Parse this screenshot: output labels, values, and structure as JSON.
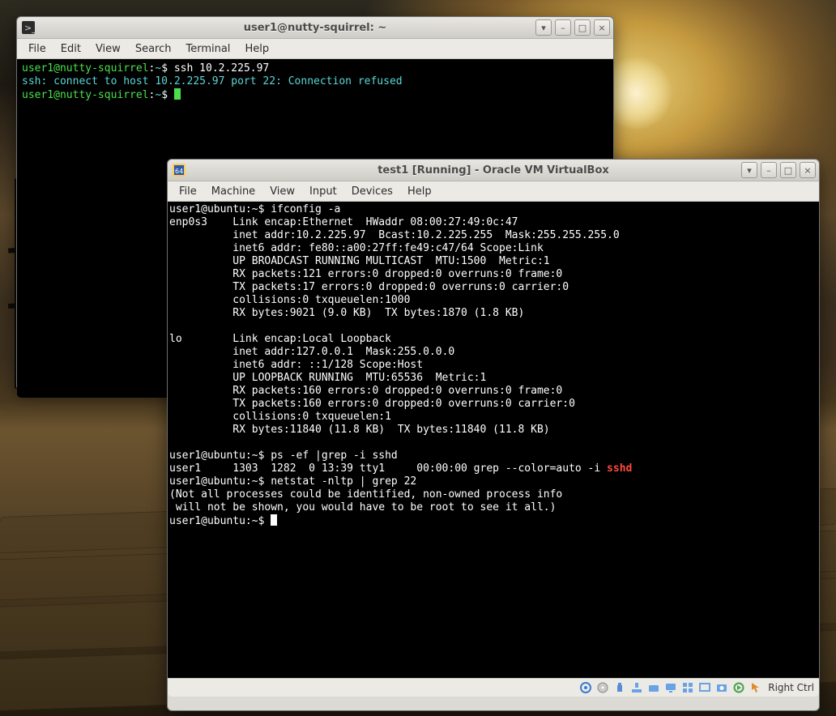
{
  "host_window": {
    "title": "user1@nutty-squirrel: ~",
    "menu": [
      "File",
      "Edit",
      "View",
      "Search",
      "Terminal",
      "Help"
    ],
    "controls": {
      "min": "–",
      "max": "□",
      "close": "×",
      "down": "▾"
    },
    "lines": {
      "p1_user": "user1@nutty-squirrel",
      "p1_path": "~",
      "p1_cmd": "ssh 10.2.225.97",
      "err": "ssh: connect to host 10.2.225.97 port 22: Connection refused",
      "p2_user": "user1@nutty-squirrel",
      "p2_path": "~"
    }
  },
  "vbox_window": {
    "title": "test1 [Running] - Oracle VM VirtualBox",
    "menu": [
      "File",
      "Machine",
      "View",
      "Input",
      "Devices",
      "Help"
    ],
    "controls": {
      "min": "–",
      "max": "□",
      "close": "×",
      "down": "▾"
    },
    "hostkey": "Right Ctrl",
    "status_icons": [
      "settings-icon",
      "cd-icon",
      "usb-icon",
      "network-icon",
      "shared-folder-icon",
      "display-icon",
      "fullscreen-icon",
      "seamless-icon",
      "snapshot-icon",
      "recording-icon",
      "mouse-icon"
    ],
    "term": {
      "l01": "user1@ubuntu:~$ ifconfig -a",
      "l02": "enp0s3    Link encap:Ethernet  HWaddr 08:00:27:49:0c:47",
      "l03": "          inet addr:10.2.225.97  Bcast:10.2.225.255  Mask:255.255.255.0",
      "l04": "          inet6 addr: fe80::a00:27ff:fe49:c47/64 Scope:Link",
      "l05": "          UP BROADCAST RUNNING MULTICAST  MTU:1500  Metric:1",
      "l06": "          RX packets:121 errors:0 dropped:0 overruns:0 frame:0",
      "l07": "          TX packets:17 errors:0 dropped:0 overruns:0 carrier:0",
      "l08": "          collisions:0 txqueuelen:1000",
      "l09": "          RX bytes:9021 (9.0 KB)  TX bytes:1870 (1.8 KB)",
      "l10": "",
      "l11": "lo        Link encap:Local Loopback",
      "l12": "          inet addr:127.0.0.1  Mask:255.0.0.0",
      "l13": "          inet6 addr: ::1/128 Scope:Host",
      "l14": "          UP LOOPBACK RUNNING  MTU:65536  Metric:1",
      "l15": "          RX packets:160 errors:0 dropped:0 overruns:0 frame:0",
      "l16": "          TX packets:160 errors:0 dropped:0 overruns:0 carrier:0",
      "l17": "          collisions:0 txqueuelen:1",
      "l18": "          RX bytes:11840 (11.8 KB)  TX bytes:11840 (11.8 KB)",
      "l19": "",
      "l20": "user1@ubuntu:~$ ps -ef |grep -i sshd",
      "l21a": "user1     1303  1282  0 13:39 tty1     00:00:00 grep --color=auto -i ",
      "l21b": "sshd",
      "l22": "user1@ubuntu:~$ netstat -nltp | grep 22",
      "l23": "(Not all processes could be identified, non-owned process info",
      "l24": " will not be shown, you would have to be root to see it all.)",
      "l25": "user1@ubuntu:~$ "
    }
  }
}
